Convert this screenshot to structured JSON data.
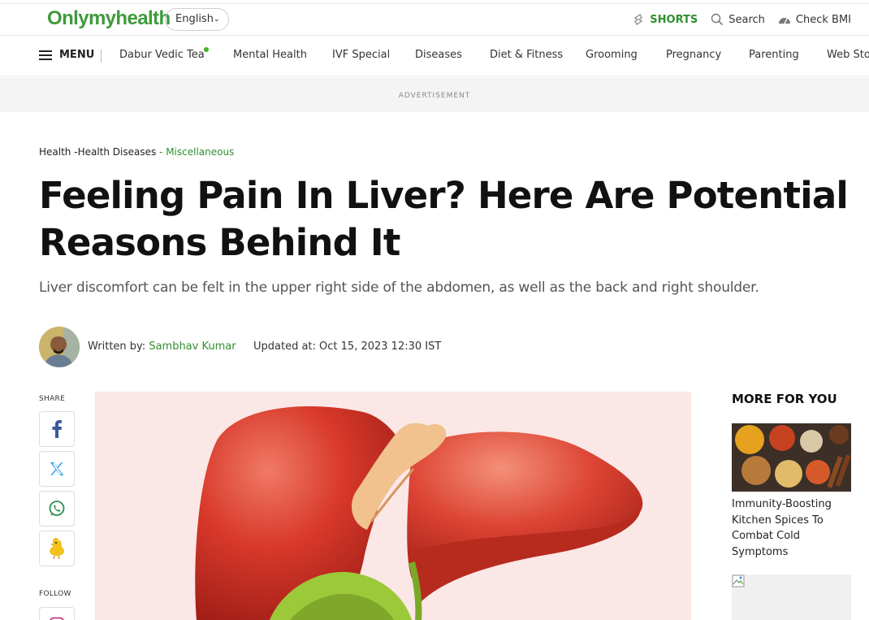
{
  "header": {
    "logo": "Onlymyhealth",
    "language": "English",
    "shorts": "SHORTS",
    "search": "Search",
    "check_bmi": "Check BMI"
  },
  "nav": {
    "menu": "MENU",
    "items": [
      "Dabur Vedic Tea",
      "Mental Health",
      "IVF Special",
      "Diseases",
      "Diet & Fitness",
      "Grooming",
      "Pregnancy",
      "Parenting",
      "Web Sto"
    ]
  },
  "ad": {
    "label": "ADVERTISEMENT"
  },
  "breadcrumb": {
    "a": "Health",
    "b": "-Health Diseases",
    "c": "- Miscellaneous"
  },
  "article": {
    "title": "Feeling Pain In Liver? Here Are Potential Reasons Behind It",
    "subtitle": "Liver discomfort can be felt in the upper right side of the abdomen, as well as the back and right shoulder.",
    "written_by": "Written by: ",
    "author": "Sambhav Kumar",
    "updated": "Updated at: Oct 15, 2023 12:30 IST"
  },
  "share": {
    "label": "SHARE",
    "follow": "FOLLOW"
  },
  "sidebar": {
    "title": "MORE FOR YOU",
    "card1_title": "Immunity-Boosting Kitchen Spices To Combat Cold Symptoms"
  },
  "icons": {
    "shorts": "shorts-icon",
    "search": "search-icon",
    "bmi": "gauge-icon",
    "facebook": "facebook-icon",
    "x": "x-icon",
    "whatsapp": "whatsapp-icon",
    "koo": "koo-icon",
    "instagram": "instagram-icon"
  },
  "colors": {
    "brand_green": "#3f9a3c",
    "link_green": "#2f8f2f",
    "hero_bg": "#fbe7e5"
  }
}
